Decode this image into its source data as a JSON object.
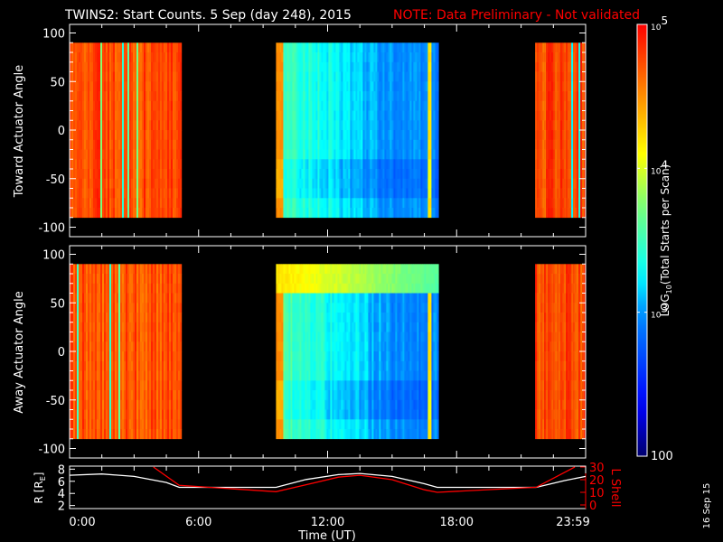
{
  "title": {
    "main": "TWINS2: Start Counts.  5 Sep (day 248), 2015",
    "note": "NOTE: Data Preliminary - Not validated",
    "note_color": "#ff0000"
  },
  "side_label": "16 Sep 15",
  "chart_data": [
    {
      "type": "heatmap",
      "name": "toward",
      "ylabel": "Toward Actuator Angle",
      "ylim": [
        -110,
        110
      ],
      "yticks": [
        "100",
        "50",
        "0",
        "-50",
        "-100"
      ],
      "ytick_values": [
        100,
        50,
        0,
        -50,
        -100
      ],
      "angle_range": [
        -90,
        90
      ],
      "xlim_hours": [
        0,
        24
      ],
      "segments": [
        {
          "start_h": 0.0,
          "end_h": 5.15,
          "log_mean": 4.75,
          "log_spread": 0.15,
          "dropout_rate": 0.06
        },
        {
          "start_h": 9.6,
          "end_h": 17.1,
          "log_start": 3.55,
          "log_end": 2.95,
          "log_spread": 0.12,
          "bright_stripe_h": 16.7
        },
        {
          "start_h": 21.65,
          "end_h": 24.0,
          "log_mean": 4.75,
          "log_spread": 0.15,
          "dropout_rate": 0.05
        }
      ]
    },
    {
      "type": "heatmap",
      "name": "away",
      "ylabel": "Away Actuator Angle",
      "ylim": [
        -110,
        110
      ],
      "yticks": [
        "100",
        "50",
        "0",
        "-50",
        "-100"
      ],
      "ytick_values": [
        100,
        50,
        0,
        -50,
        -100
      ],
      "angle_range": [
        -90,
        90
      ],
      "xlim_hours": [
        0,
        24
      ],
      "segments": [
        {
          "start_h": 0.0,
          "end_h": 5.15,
          "log_mean": 4.72,
          "log_spread": 0.15,
          "dropout_rate": 0.06
        },
        {
          "start_h": 9.6,
          "end_h": 17.1,
          "log_start": 3.6,
          "log_end": 2.95,
          "log_spread": 0.12,
          "bright_stripe_h": 16.7,
          "top_band_log": 4.2
        },
        {
          "start_h": 21.65,
          "end_h": 24.0,
          "log_mean": 4.75,
          "log_spread": 0.15,
          "dropout_rate": 0.05
        }
      ]
    },
    {
      "type": "line",
      "name": "orbit",
      "xlabel": "Time (UT)",
      "xticks": [
        "0:00",
        "6:00",
        "12:00",
        "18:00",
        "23:59"
      ],
      "xtick_hours": [
        0,
        6,
        12,
        18,
        24
      ],
      "ylabel_left": "R [RE]",
      "ylabel_left_main": "R [R",
      "ylabel_left_sub": "E",
      "ylabel_left_end": "]",
      "ylim_left": [
        1.5,
        8.5
      ],
      "yticks_left": [
        "8",
        "6",
        "4",
        "2"
      ],
      "ytick_left_values": [
        8,
        6,
        4,
        2
      ],
      "ylabel_right": "L Shell",
      "ylim_right": [
        0,
        30
      ],
      "yticks_right": [
        "30",
        "20",
        "10",
        "0"
      ],
      "ytick_right_values": [
        30,
        20,
        10,
        0
      ],
      "series": [
        {
          "name": "R",
          "color": "#ffffff",
          "x": [
            0,
            1.5,
            3,
            4.5,
            5.1,
            9.6,
            11,
            12.5,
            13.5,
            15,
            16.5,
            17.1,
            21.7,
            23,
            24
          ],
          "y": [
            7.0,
            7.2,
            6.8,
            5.8,
            5.0,
            5.0,
            6.3,
            7.1,
            7.3,
            6.8,
            5.6,
            5.0,
            5.0,
            6.1,
            6.8
          ]
        },
        {
          "name": "L Shell",
          "color": "#ff0000",
          "x": [
            3.9,
            5.1,
            9.6,
            11,
            12.5,
            13.5,
            15,
            16.5,
            17.1,
            21.7,
            23.5
          ],
          "y": [
            30,
            15.5,
            10.5,
            16,
            22,
            23.5,
            20,
            12,
            10,
            14,
            30
          ]
        }
      ]
    },
    {
      "type": "colorbar",
      "label_main": "LOG",
      "label_sub": "10",
      "label_rest": "(Total Starts per Scan)",
      "range": [
        100,
        100000
      ],
      "ticks": [
        {
          "base": "10",
          "exp": "5",
          "log": 5
        },
        {
          "base": "10",
          "exp": "4",
          "log": 4
        },
        {
          "base": "10",
          "exp": "3",
          "log": 3
        }
      ],
      "min_label": "100"
    }
  ]
}
